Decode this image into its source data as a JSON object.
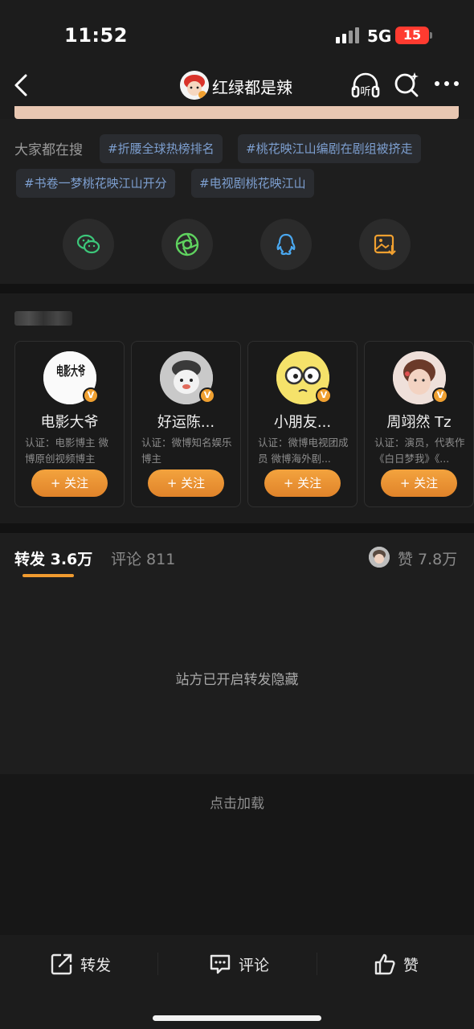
{
  "status_bar": {
    "time": "11:52",
    "network": "5G",
    "battery": "15"
  },
  "nav": {
    "title": "红绿都是辣",
    "listen_label": "听"
  },
  "hot_search": {
    "label": "大家都在搜",
    "tags": [
      "#折腰全球热榜排名",
      "#桃花映江山编剧在剧组被挤走",
      "#书卷一梦桃花映江山开分",
      "#电视剧桃花映江山"
    ]
  },
  "share": [
    {
      "icon": "wechat-icon",
      "color": "#3cc77a"
    },
    {
      "icon": "moments-icon",
      "color": "#5fd35f"
    },
    {
      "icon": "qq-icon",
      "color": "#4aa8f0"
    },
    {
      "icon": "save-image-icon",
      "color": "#f0a030"
    }
  ],
  "recommend": {
    "cards": [
      {
        "name": "电影大爷",
        "desc": "认证：电影博主 微博原创视频博主",
        "follow": "+ 关注",
        "avatar_text": "电影大爷"
      },
      {
        "name": "好运陈...",
        "desc": "认证：微博知名娱乐博主",
        "follow": "+ 关注"
      },
      {
        "name": "小朋友...",
        "desc": "认证：微博电视团成员 微博海外剧...",
        "follow": "+ 关注"
      },
      {
        "name": "周翊然 Tz",
        "desc": "认证：演员，代表作《白日梦我》《...",
        "follow": "+ 关注"
      }
    ],
    "verified_badge": "V"
  },
  "tabs": {
    "repost": "转发 3.6万",
    "comment": "评论 811",
    "like": "赞 7.8万"
  },
  "hidden_notice": "站方已开启转发隐藏",
  "load_more": "点击加载",
  "bottom_bar": {
    "repost": "转发",
    "comment": "评论",
    "like": "赞"
  },
  "colors": {
    "accent": "#f09b2f",
    "tag_text": "#7d9fd0",
    "battery": "#ff3b30"
  }
}
